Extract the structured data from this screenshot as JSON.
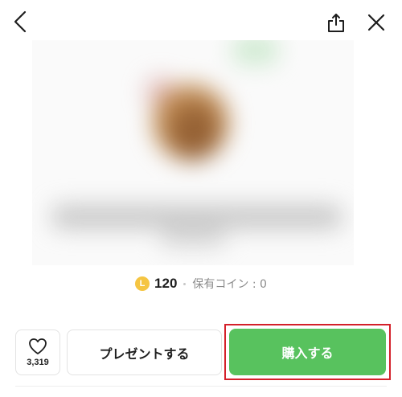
{
  "header": {
    "back_icon": "chevron-left-icon",
    "share_icon": "share-icon",
    "close_icon": "close-icon"
  },
  "product": {
    "image": "blurred-product-image"
  },
  "price": {
    "coin_letter": "L",
    "amount": "120",
    "owned_coins": "保有コイン : 0"
  },
  "actions": {
    "like_count": "3,319",
    "present_label": "プレゼントする",
    "buy_label": "購入する"
  },
  "colors": {
    "buy_green": "#58c25e",
    "highlight_red": "#d4202a",
    "coin_yellow": "#f5c542"
  }
}
